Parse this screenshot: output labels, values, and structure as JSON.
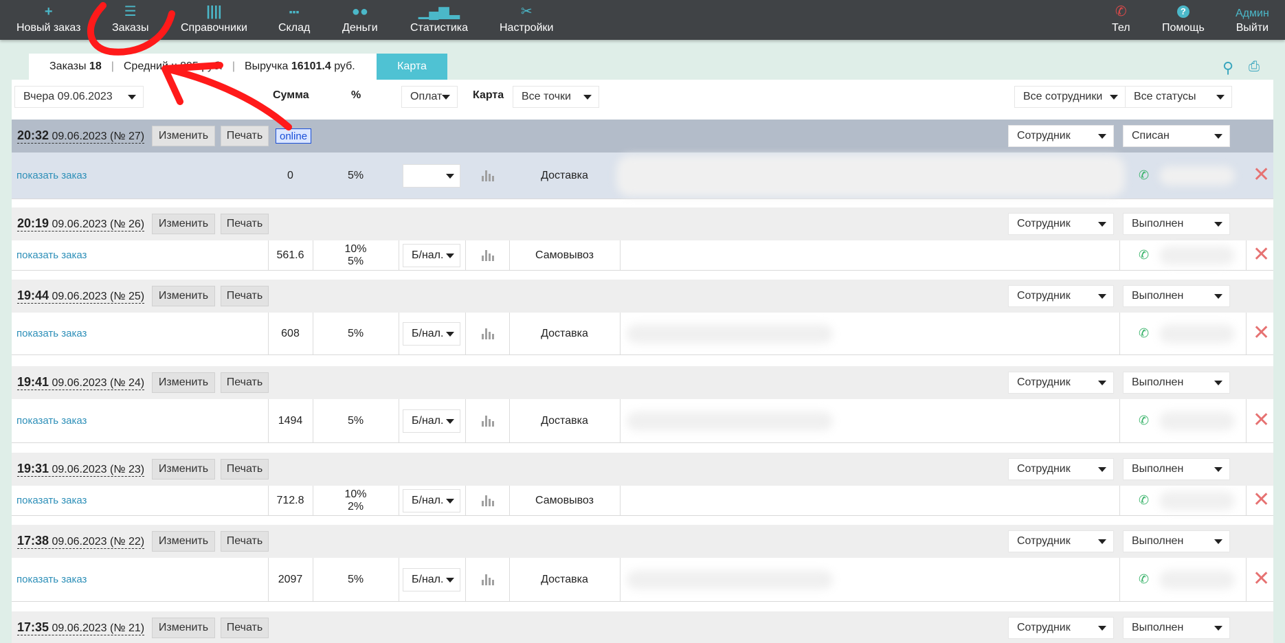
{
  "nav": {
    "new_order": {
      "label": "Новый заказ",
      "icon": "plus-icon"
    },
    "orders": {
      "label": "Заказы",
      "icon": "list-icon"
    },
    "references": {
      "label": "Справочники",
      "icon": "columns-icon"
    },
    "warehouse": {
      "label": "Склад",
      "icon": "grid-icon"
    },
    "money": {
      "label": "Деньги",
      "icon": "coins-icon"
    },
    "stats": {
      "label": "Статистика",
      "icon": "bar-chart-icon"
    },
    "settings": {
      "label": "Настройки",
      "icon": "tools-icon"
    },
    "phone": {
      "label": "Тел",
      "icon": "phone-icon"
    },
    "help": {
      "label": "Помощь",
      "icon": "help-icon"
    },
    "user": {
      "name": "Админ",
      "logout": "Выйти"
    }
  },
  "summary": {
    "orders_label": "Заказы",
    "orders_count": "18",
    "avg_label": "Средний ч",
    "avg_value": "895 руб.",
    "revenue_label": "Выручка",
    "revenue_value": "16101.4",
    "revenue_unit": "руб.",
    "map_button": "Карта"
  },
  "filters": {
    "date": "Вчера 09.06.2023",
    "sum_header": "Сумма",
    "pct_header": "%",
    "payment": "Оплат",
    "map_header": "Карта",
    "points": "Все точки",
    "employees": "Все сотрудники",
    "statuses": "Все статусы"
  },
  "labels": {
    "edit": "Изменить",
    "print": "Печать",
    "show_order": "показать заказ",
    "employee": "Сотрудник"
  },
  "orders": [
    {
      "time": "20:32",
      "date": "09.06.2023 (№ 27)",
      "online": "online",
      "status": "Списан",
      "sum": "0",
      "pct1": "5%",
      "pct2": "",
      "payment": "",
      "delivery": "Доставка"
    },
    {
      "time": "20:19",
      "date": "09.06.2023 (№ 26)",
      "status": "Выполнен",
      "sum": "561.6",
      "pct1": "10%",
      "pct2": "5%",
      "payment": "Б/нал.",
      "delivery": "Самовывоз"
    },
    {
      "time": "19:44",
      "date": "09.06.2023 (№ 25)",
      "status": "Выполнен",
      "sum": "608",
      "pct1": "5%",
      "pct2": "",
      "payment": "Б/нал.",
      "delivery": "Доставка"
    },
    {
      "time": "19:41",
      "date": "09.06.2023 (№ 24)",
      "status": "Выполнен",
      "sum": "1494",
      "pct1": "5%",
      "pct2": "",
      "payment": "Б/нал.",
      "delivery": "Доставка"
    },
    {
      "time": "19:31",
      "date": "09.06.2023 (№ 23)",
      "status": "Выполнен",
      "sum": "712.8",
      "pct1": "10%",
      "pct2": "2%",
      "payment": "Б/нал.",
      "delivery": "Самовывоз"
    },
    {
      "time": "17:38",
      "date": "09.06.2023 (№ 22)",
      "status": "Выполнен",
      "sum": "2097",
      "pct1": "5%",
      "pct2": "",
      "payment": "Б/нал.",
      "delivery": "Доставка"
    },
    {
      "time": "17:35",
      "date": "09.06.2023 (№ 21)",
      "status": "Выполнен"
    }
  ],
  "colors": {
    "accent": "#4bb8c9",
    "topbar": "#404346",
    "annotation": "#ff1a1a"
  }
}
